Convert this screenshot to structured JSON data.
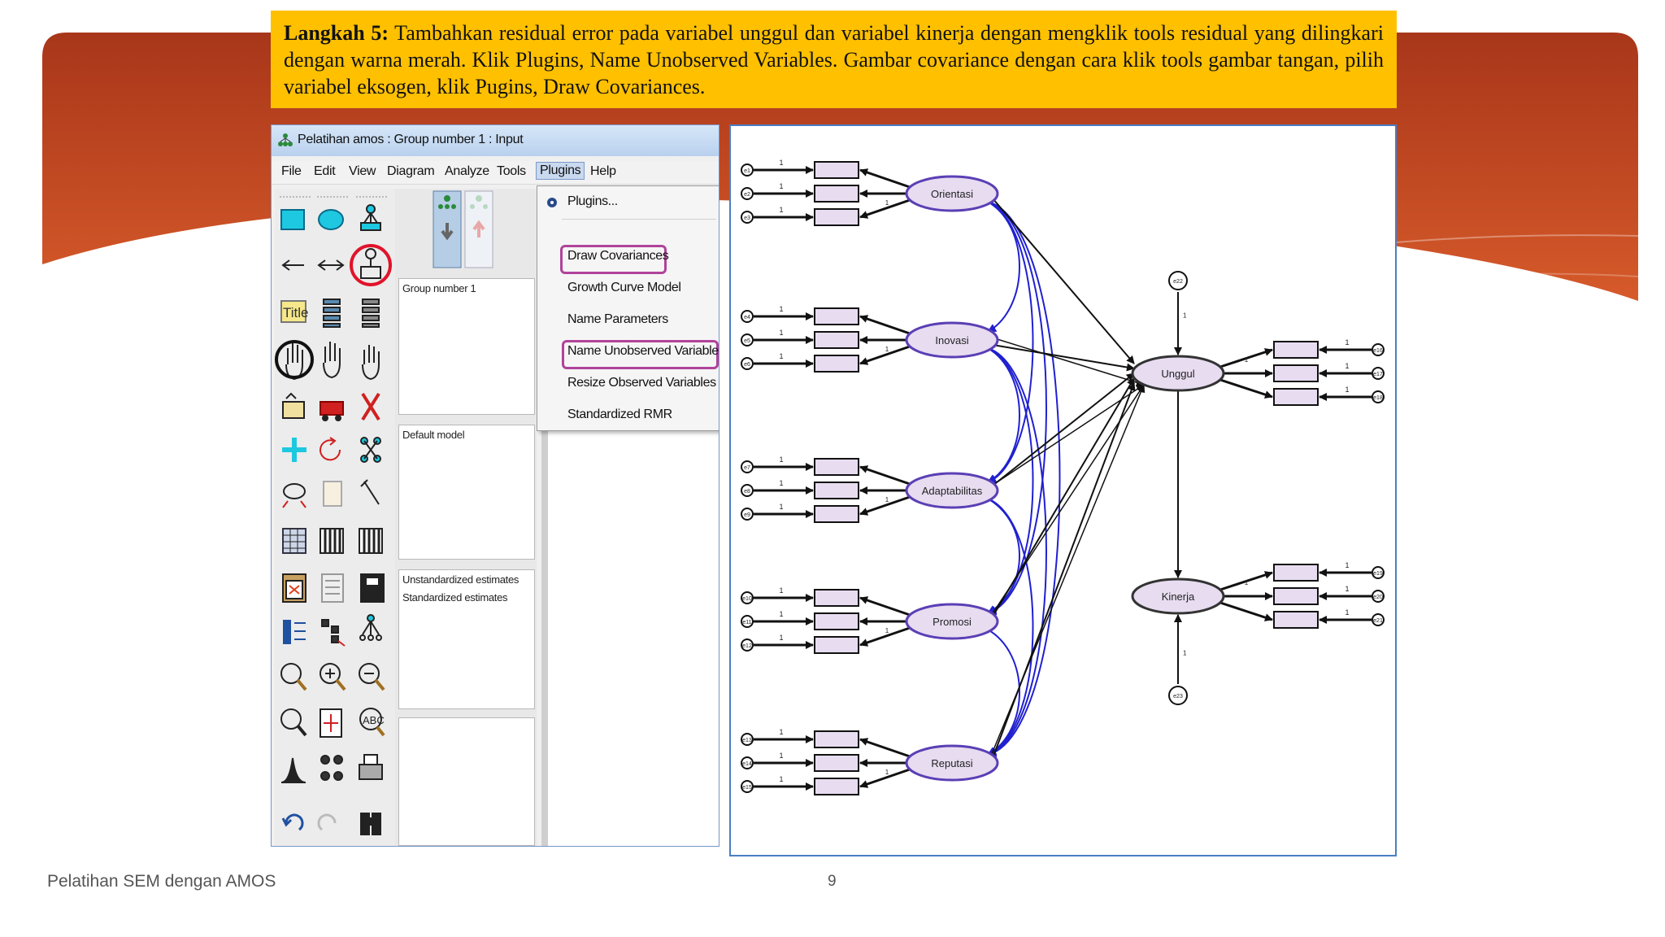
{
  "slide": {
    "step_label": "Langkah 5:",
    "step_text": " Tambahkan residual error pada variabel unggul dan variabel kinerja dengan mengklik tools residual yang dilingkari dengan warna merah. Klik Plugins, Name Unobserved Variables. Gambar covariance dengan cara klik tools gambar tangan, pilih variabel eksogen, klik Pugins, Draw Covariances.",
    "footer_text": "Pelatihan SEM dengan AMOS",
    "page_number": "9",
    "colors": {
      "banner": "#c0441e",
      "step_box": "#ffc000",
      "red_circle": "#e0142a",
      "purple_highlight": "#b0439a",
      "latent_fill": "#e7dcf0",
      "latent_border": "#5b3fb5",
      "covariance": "#2020d0"
    }
  },
  "amos": {
    "title": "Pelatihan amos : Group number 1 : Input",
    "menu": [
      "File",
      "Edit",
      "View",
      "Diagram",
      "Analyze",
      "Tools",
      "Plugins",
      "Help"
    ],
    "active_menu": "Plugins",
    "tools": [
      "rectangle-icon",
      "ellipse-icon",
      "indicator-icon",
      "single-arrow-icon",
      "double-arrow-icon",
      "residual-icon",
      "title-icon",
      "list-variables-icon",
      "list-objects-icon",
      "hand-select-icon",
      "hand-select-all-icon",
      "hand-deselect-icon",
      "duplicate-icon",
      "move-icon",
      "erase-icon",
      "shape-change-icon",
      "rotate-icon",
      "reflect-icon",
      "move-parameters-icon",
      "scroll-icon",
      "touch-up-icon",
      "data-file-icon",
      "analysis-properties-icon",
      "calculate-estimates-icon",
      "clipboard-icon",
      "text-output-icon",
      "save-icon",
      "object-properties-icon",
      "drag-properties-icon",
      "preserve-symmetry-icon",
      "zoom-select-icon",
      "zoom-in-icon",
      "zoom-out-icon",
      "view-page-icon",
      "fit-page-icon",
      "loupe-icon",
      "bayesian-icon",
      "multiple-group-icon",
      "print-icon",
      "undo-icon",
      "redo-icon",
      "specification-search-icon"
    ],
    "panels": {
      "group": "Group number 1",
      "model": "Default model",
      "estimates": [
        "Unstandardized estimates",
        "Standardized estimates"
      ]
    },
    "plugins_menu": [
      "Plugins...",
      "Draw Covariances",
      "Growth Curve Model",
      "Name Parameters",
      "Name Unobserved Variables",
      "Resize Observed Variables",
      "Standardized RMR"
    ],
    "highlighted_items": [
      "Draw Covariances",
      "Name Unobserved Variables"
    ]
  },
  "sem": {
    "exogenous": [
      "Orientasi",
      "Inovasi",
      "Adaptabilitas",
      "Promosi",
      "Reputasi"
    ],
    "endogenous": [
      "Unggul",
      "Kinerja"
    ],
    "residuals_left": [
      [
        "e1",
        "e2",
        "e3"
      ],
      [
        "e4",
        "e5",
        "e6"
      ],
      [
        "e7",
        "e8",
        "e9"
      ],
      [
        "e10",
        "e11",
        "e12"
      ],
      [
        "e13",
        "e14",
        "e15"
      ]
    ],
    "residuals_right": [
      [
        "e16",
        "e17",
        "e18"
      ],
      [
        "e19",
        "e20",
        "e21"
      ]
    ],
    "structural_residuals": [
      "e22",
      "e23"
    ],
    "path_weight": "1"
  }
}
